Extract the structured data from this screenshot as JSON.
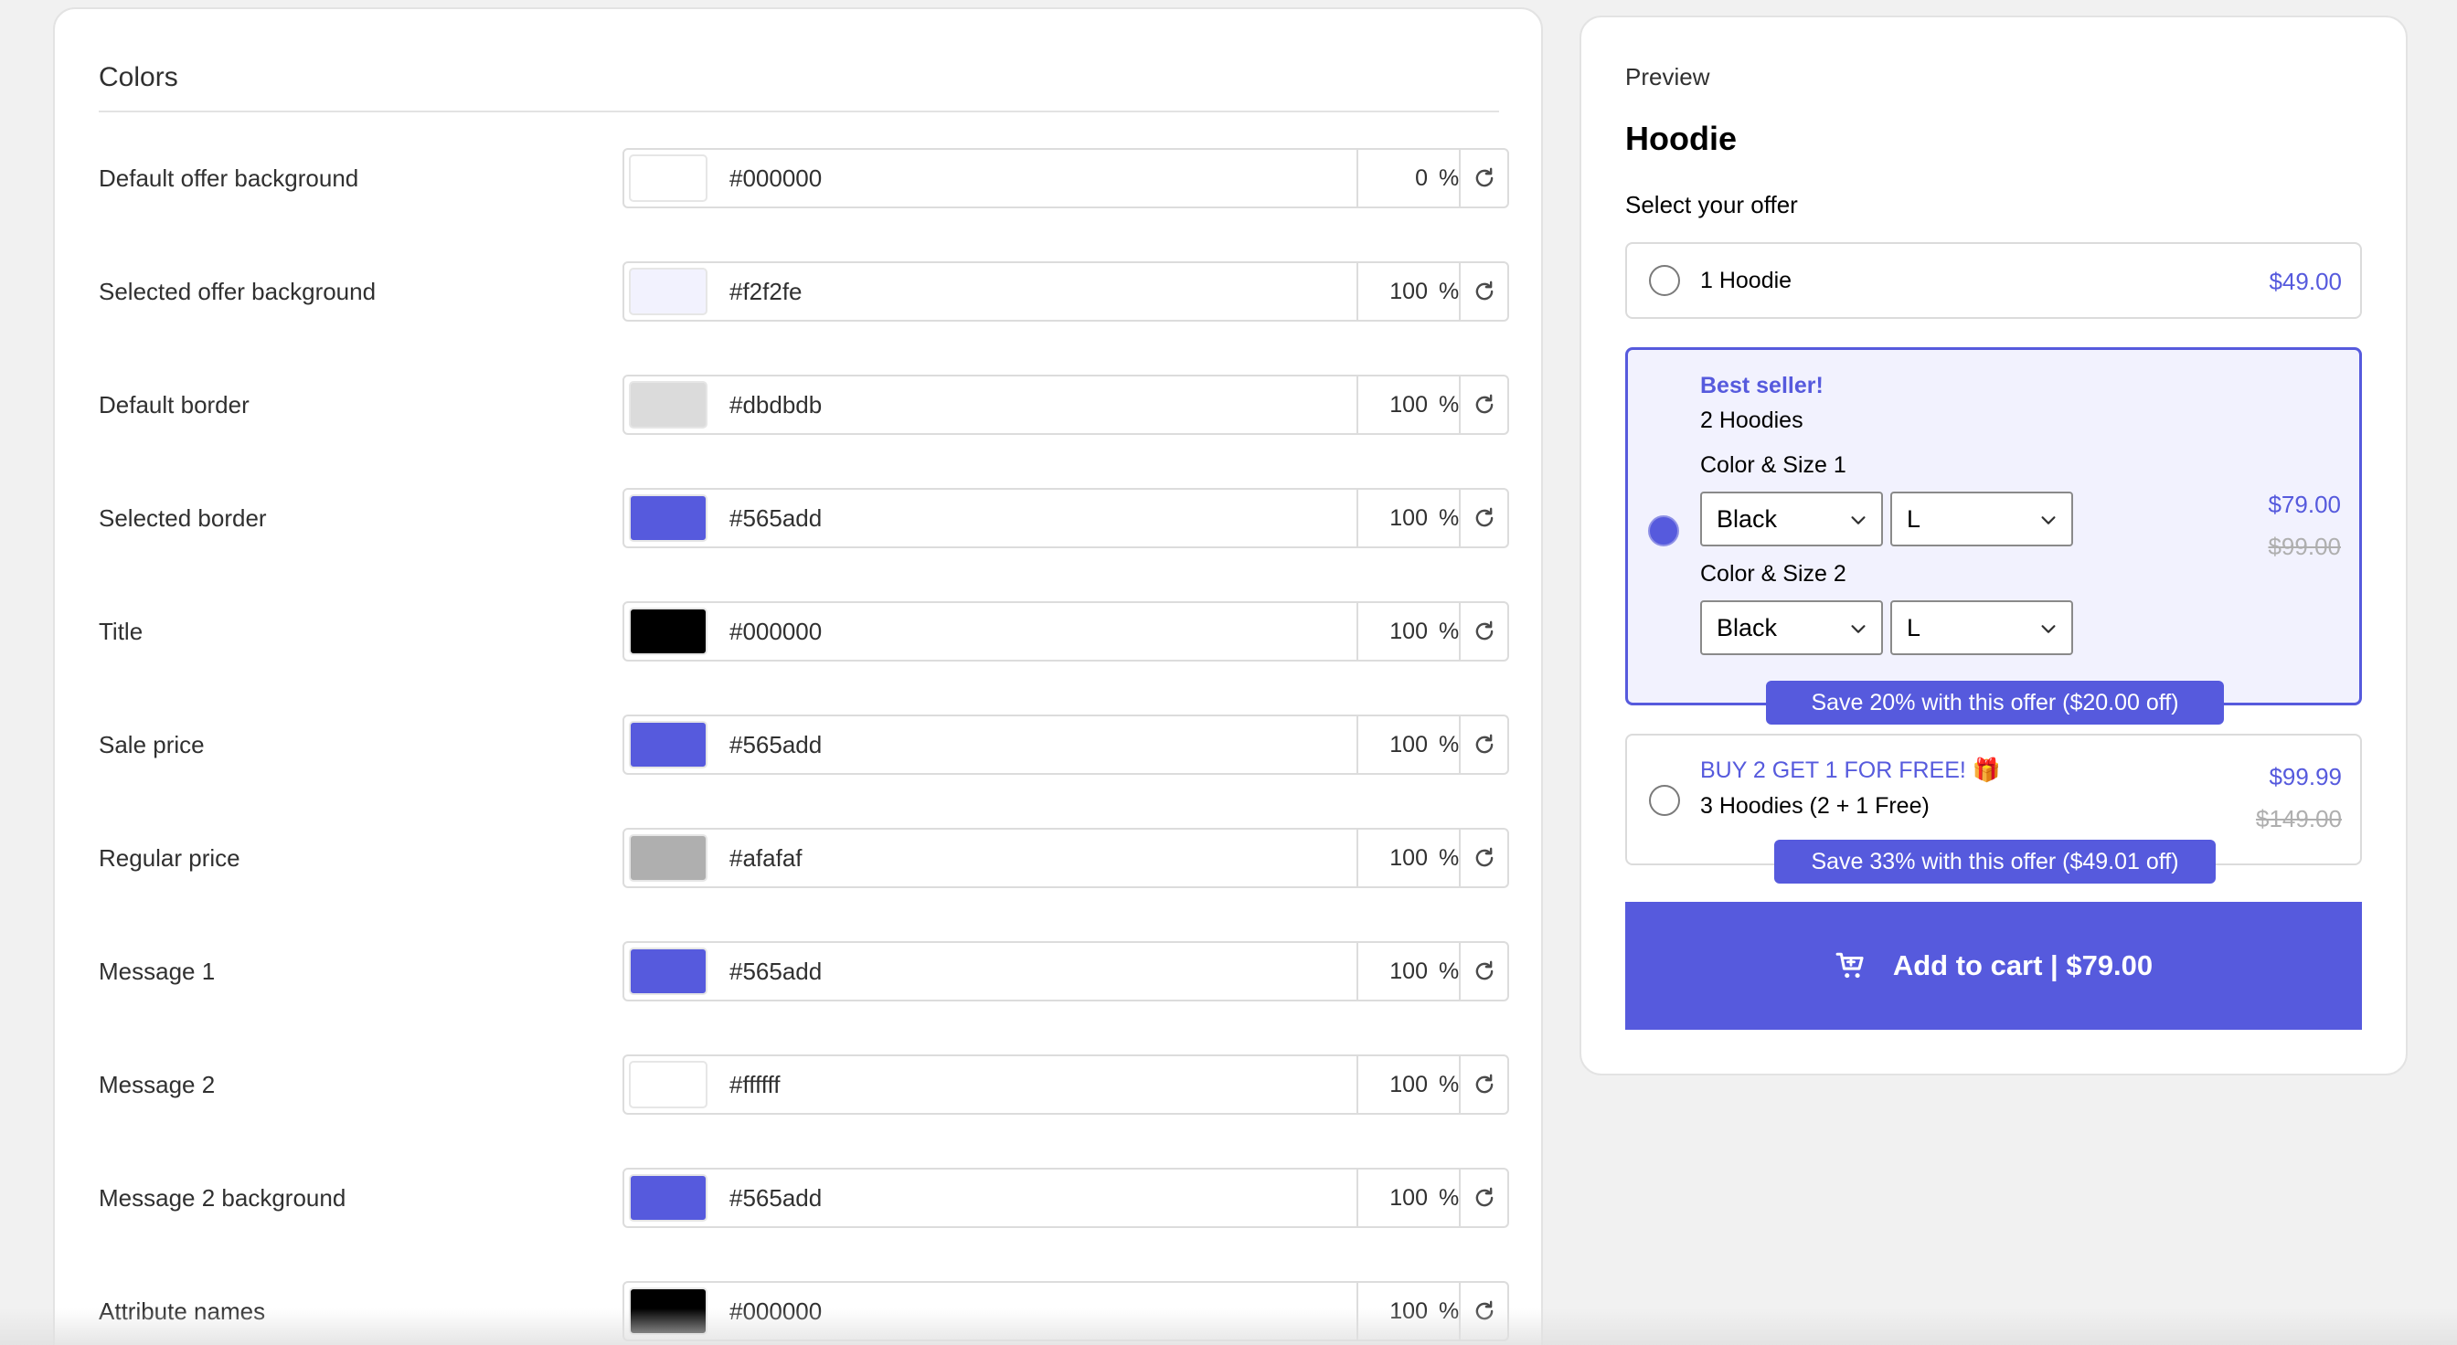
{
  "colors": {
    "title": "Colors",
    "rows": [
      {
        "label": "Default offer background",
        "hex": "#000000",
        "opacity": "0",
        "unit": "%",
        "swatch": "#ffffff"
      },
      {
        "label": "Selected offer background",
        "hex": "#f2f2fe",
        "opacity": "100",
        "unit": "%",
        "swatch": "#f2f2fe"
      },
      {
        "label": "Default border",
        "hex": "#dbdbdb",
        "opacity": "100",
        "unit": "%",
        "swatch": "#dbdbdb"
      },
      {
        "label": "Selected border",
        "hex": "#565add",
        "opacity": "100",
        "unit": "%",
        "swatch": "#565add"
      },
      {
        "label": "Title",
        "hex": "#000000",
        "opacity": "100",
        "unit": "%",
        "swatch": "#000000"
      },
      {
        "label": "Sale price",
        "hex": "#565add",
        "opacity": "100",
        "unit": "%",
        "swatch": "#565add"
      },
      {
        "label": "Regular price",
        "hex": "#afafaf",
        "opacity": "100",
        "unit": "%",
        "swatch": "#afafaf"
      },
      {
        "label": "Message 1",
        "hex": "#565add",
        "opacity": "100",
        "unit": "%",
        "swatch": "#565add"
      },
      {
        "label": "Message 2",
        "hex": "#ffffff",
        "opacity": "100",
        "unit": "%",
        "swatch": "#ffffff"
      },
      {
        "label": "Message 2 background",
        "hex": "#565add",
        "opacity": "100",
        "unit": "%",
        "swatch": "#565add"
      },
      {
        "label": "Attribute names",
        "hex": "#000000",
        "opacity": "100",
        "unit": "%",
        "swatch": "#000000"
      }
    ],
    "reset_icon": "refresh-icon"
  },
  "preview": {
    "label": "Preview",
    "product_title": "Hoodie",
    "select_label": "Select your offer",
    "accent_color": "#565add",
    "offers": [
      {
        "name": "1 Hoodie",
        "price": "$49.00",
        "selected": false
      },
      {
        "tag": "Best seller!",
        "name": "2 Hoodies",
        "price": "$79.00",
        "regular_price": "$99.00",
        "selected": true,
        "variants": [
          {
            "label": "Color & Size 1",
            "color": "Black",
            "size": "L"
          },
          {
            "label": "Color & Size 2",
            "color": "Black",
            "size": "L"
          }
        ],
        "badge": "Save 20% with this offer ($20.00 off)"
      },
      {
        "tag": "BUY 2 GET 1 FOR FREE! 🎁",
        "name": "3 Hoodies (2 + 1 Free)",
        "price": "$99.99",
        "regular_price": "$149.00",
        "selected": false,
        "badge": "Save 33% with this offer ($49.01 off)"
      }
    ],
    "add_to_cart": {
      "label": "Add to cart | $79.00",
      "icon": "cart-icon"
    }
  }
}
